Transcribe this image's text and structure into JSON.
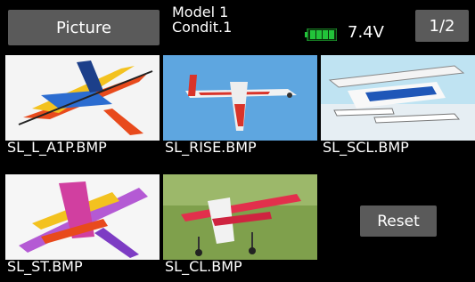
{
  "header": {
    "title": "Picture",
    "model": "Model 1",
    "condition": "Condit.1",
    "voltage": "7.4V",
    "page": "1/2",
    "battery_color": "#22c33a"
  },
  "pictures": [
    {
      "filename": "SL_L_A1P.BMP"
    },
    {
      "filename": "SL_RISE.BMP"
    },
    {
      "filename": "SL_SCL.BMP"
    },
    {
      "filename": "SL_ST.BMP"
    },
    {
      "filename": "SL_CL.BMP"
    }
  ],
  "reset_label": "Reset"
}
